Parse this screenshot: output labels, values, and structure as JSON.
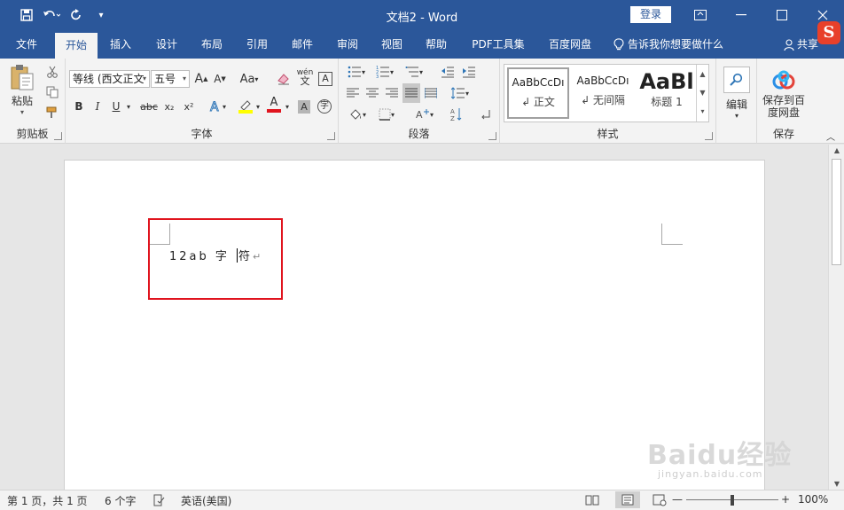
{
  "window": {
    "title": "文档2  -  Word",
    "login_label": "登录"
  },
  "quick_access": {
    "save_icon": "save-icon",
    "undo_icon": "undo-icon",
    "redo_icon": "redo-icon"
  },
  "tabs": [
    {
      "label": "文件"
    },
    {
      "label": "开始"
    },
    {
      "label": "插入"
    },
    {
      "label": "设计"
    },
    {
      "label": "布局"
    },
    {
      "label": "引用"
    },
    {
      "label": "邮件"
    },
    {
      "label": "审阅"
    },
    {
      "label": "视图"
    },
    {
      "label": "帮助"
    },
    {
      "label": "PDF工具集"
    },
    {
      "label": "百度网盘"
    }
  ],
  "tell_me": "告诉我你想要做什么",
  "share_label": "共享",
  "ribbon": {
    "clipboard": {
      "label": "剪贴板",
      "paste_label": "粘贴"
    },
    "font": {
      "label": "字体",
      "font_name": "等线 (西文正文",
      "font_size": "五号",
      "change_case": "Aa",
      "bold": "B",
      "italic": "I",
      "underline": "U",
      "strike": "abc",
      "sub": "x₂",
      "sup": "x²",
      "pinyin": "wén",
      "char_border": "A",
      "char_shade": "A",
      "enclose": "字",
      "grow": "A",
      "shrink": "A"
    },
    "paragraph": {
      "label": "段落"
    },
    "styles": {
      "label": "样式",
      "items": [
        {
          "sample": "AaBbCcDı",
          "name": "↲ 正文"
        },
        {
          "sample": "AaBbCcDı",
          "name": "↲ 无间隔"
        },
        {
          "sample": "AaBl",
          "name": "标题 1"
        }
      ]
    },
    "editing": {
      "label": "编辑"
    },
    "save": {
      "label": "保存",
      "button_label": "保存到百度网盘"
    }
  },
  "document": {
    "text_before_caret": "12ab 字 ",
    "text_after_caret": "符",
    "para_mark": "↵"
  },
  "statusbar": {
    "page_info": "第 1 页，共 1 页",
    "word_count": "6 个字",
    "language": "英语(美国)",
    "zoom": "100%"
  },
  "watermark": {
    "text": "Baidu经验",
    "sub": "jingyan.baidu.com"
  },
  "colors": {
    "brand": "#2b579a",
    "highlight_box": "#e0141e",
    "font_color_bar": "#e0141e",
    "highlight_bar": "#ffff00"
  }
}
